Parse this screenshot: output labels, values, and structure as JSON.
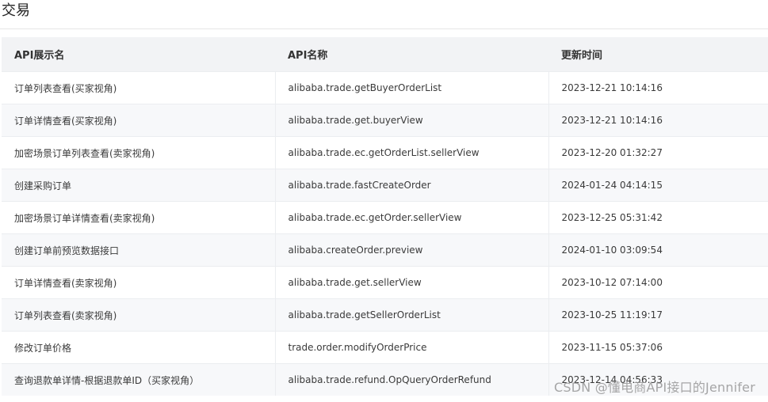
{
  "section_title": "交易",
  "table": {
    "headers": {
      "display_name": "API展示名",
      "api_name": "API名称",
      "updated_at": "更新时间"
    },
    "rows": [
      {
        "display_name": "订单列表查看(买家视角)",
        "api_name": "alibaba.trade.getBuyerOrderList",
        "updated_at": "2023-12-21 10:14:16"
      },
      {
        "display_name": "订单详情查看(买家视角)",
        "api_name": "alibaba.trade.get.buyerView",
        "updated_at": "2023-12-21 10:14:16"
      },
      {
        "display_name": "加密场景订单列表查看(卖家视角)",
        "api_name": "alibaba.trade.ec.getOrderList.sellerView",
        "updated_at": "2023-12-20 01:32:27"
      },
      {
        "display_name": "创建采购订单",
        "api_name": "alibaba.trade.fastCreateOrder",
        "updated_at": "2024-01-24 04:14:15"
      },
      {
        "display_name": "加密场景订单详情查看(卖家视角)",
        "api_name": "alibaba.trade.ec.getOrder.sellerView",
        "updated_at": "2023-12-25 05:31:42"
      },
      {
        "display_name": "创建订单前预览数据接口",
        "api_name": "alibaba.createOrder.preview",
        "updated_at": "2024-01-10 03:09:54"
      },
      {
        "display_name": "订单详情查看(卖家视角)",
        "api_name": "alibaba.trade.get.sellerView",
        "updated_at": "2023-10-12 07:14:00"
      },
      {
        "display_name": "订单列表查看(卖家视角)",
        "api_name": "alibaba.trade.getSellerOrderList",
        "updated_at": "2023-10-25 11:19:17"
      },
      {
        "display_name": "修改订单价格",
        "api_name": "trade.order.modifyOrderPrice",
        "updated_at": "2023-11-15 05:37:06"
      },
      {
        "display_name": "查询退款单详情-根据退款单ID（买家视角）",
        "api_name": "alibaba.trade.refund.OpQueryOrderRefund",
        "updated_at": "2023-12-14 04:56:33"
      }
    ]
  },
  "watermark": "CSDN @懂电商API接口的Jennifer"
}
